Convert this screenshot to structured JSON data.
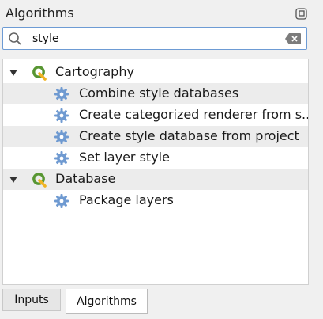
{
  "panel": {
    "title": "Algorithms"
  },
  "search": {
    "value": "style"
  },
  "tree": {
    "groups": [
      {
        "label": "Cartography",
        "items": [
          "Combine style databases",
          "Create categorized renderer from s...",
          "Create style database from project",
          "Set layer style"
        ]
      },
      {
        "label": "Database",
        "items": [
          "Package layers"
        ]
      }
    ]
  },
  "tabs": {
    "inputs": "Inputs",
    "algorithms": "Algorithms"
  },
  "icons": {
    "search": "search-icon",
    "clear": "clear-icon",
    "float": "float-icon",
    "expand": "expand-arrow-icon",
    "provider": "qgis-icon",
    "algorithm": "gear-icon"
  },
  "colors": {
    "qgis_green": "#589632",
    "gear_blue": "#6f9ad1",
    "focus_border": "#6d9bd4"
  }
}
